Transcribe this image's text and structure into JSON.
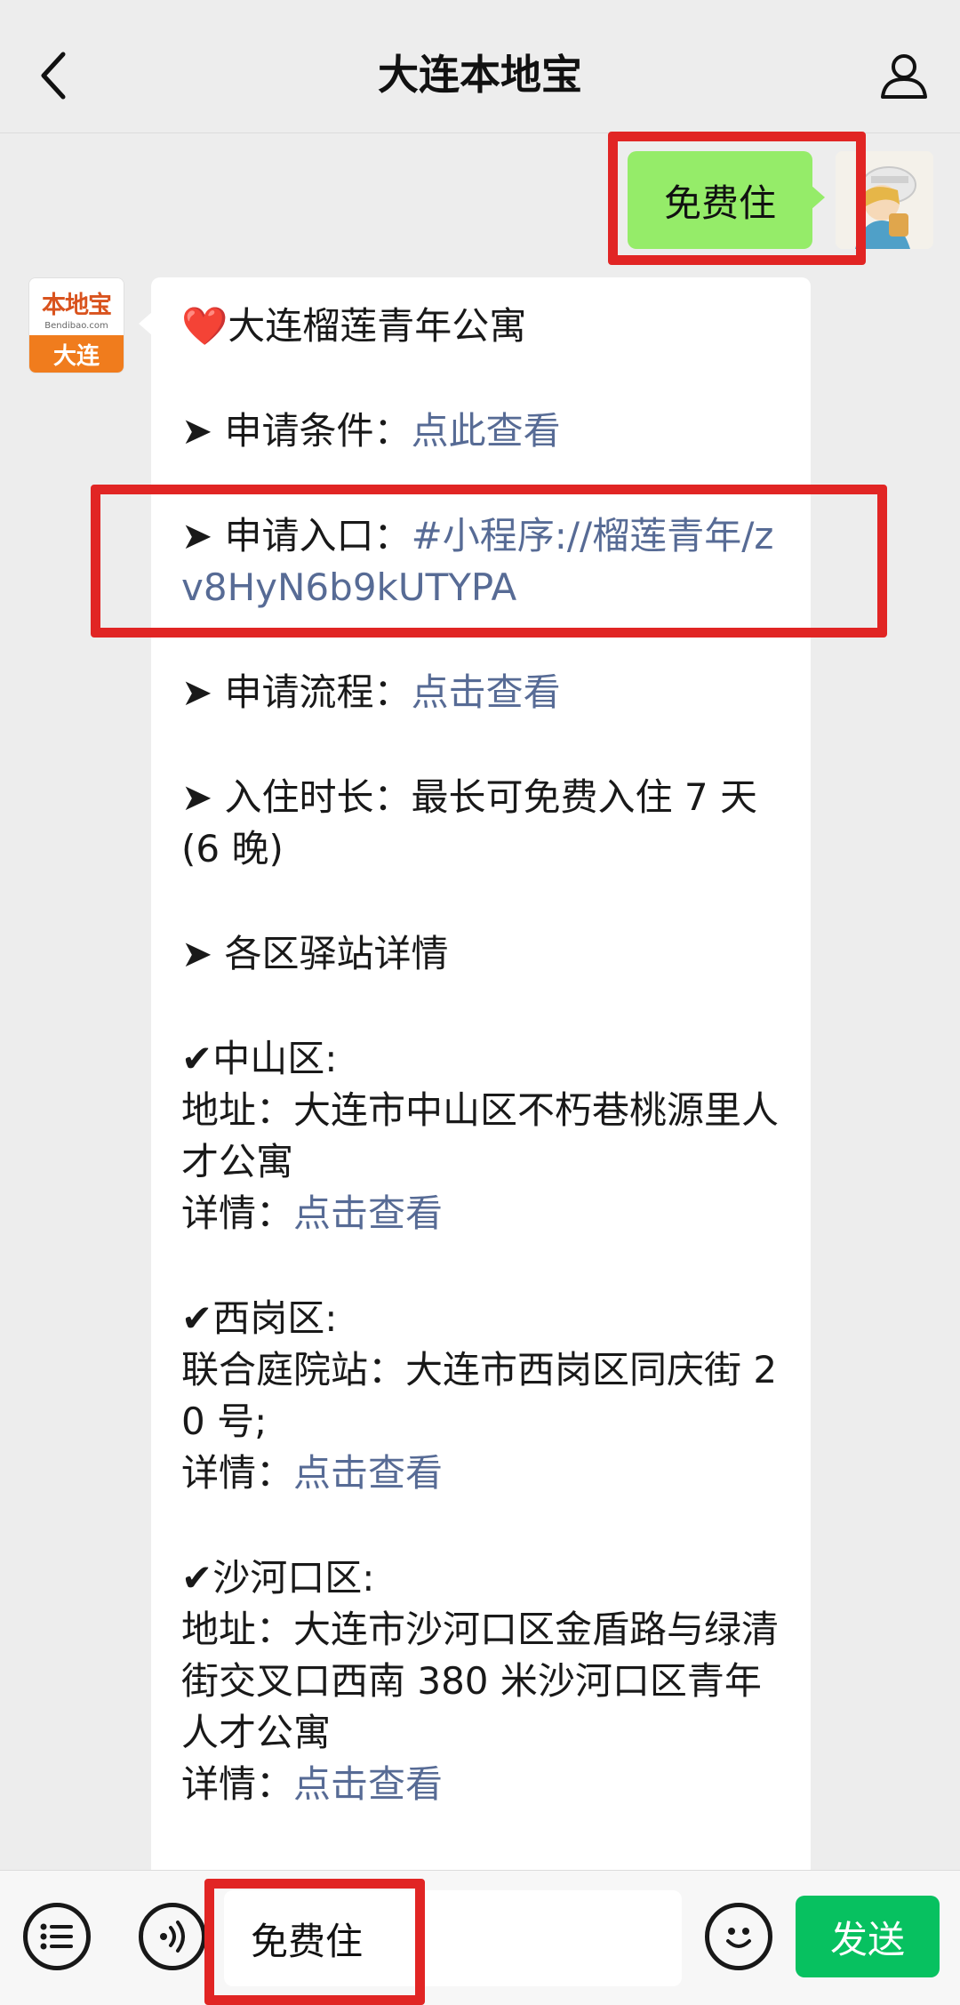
{
  "header": {
    "title": "大连本地宝",
    "back_icon": "chevron-left-icon",
    "profile_icon": "person-icon"
  },
  "outgoing": {
    "text": "免费住"
  },
  "bot_avatar": {
    "logo_text": "本地宝",
    "logo_sub": "Bendibao.com",
    "city": "大连"
  },
  "message": {
    "title": "❤️大连榴莲青年公寓",
    "items": [
      {
        "prefix": "➤ ",
        "label": "申请条件：",
        "link": "点此查看"
      },
      {
        "prefix": "➤ ",
        "label": "申请入口：",
        "link": "#小程序://榴莲青年/zv8HyN6b9kUTYPA"
      },
      {
        "prefix": "➤ ",
        "label": "申请流程：",
        "link": "点击查看"
      },
      {
        "prefix": "➤ ",
        "label": "入住时长：最长可免费入住 7 天(6 晚)"
      },
      {
        "prefix": "➤ ",
        "label": "各区驿站详情"
      }
    ],
    "districts": [
      {
        "name": "✔中山区:",
        "lines": [
          "地址：大连市中山区不朽巷桃源里人才公寓"
        ],
        "detail_label": "详情：",
        "detail_link": "点击查看"
      },
      {
        "name": "✔西岗区:",
        "lines": [
          "联合庭院站：大连市西岗区同庆街 20 号;"
        ],
        "detail_label": "详情：",
        "detail_link": "点击查看"
      },
      {
        "name": "✔沙河口区:",
        "lines": [
          "地址：大连市沙河口区金盾路与绿清街交叉口西南 380 米沙河口区青年人才公寓"
        ],
        "detail_label": "详情：",
        "detail_link": "点击查看"
      }
    ]
  },
  "input_bar": {
    "menu_icon": "list-menu-icon",
    "voice_icon": "voice-icon",
    "input_value": "免费住",
    "emoji_icon": "emoji-icon",
    "send_label": "发送"
  },
  "colors": {
    "link": "#576b95",
    "out_bubble": "#95ec69",
    "send": "#07c160",
    "highlight": "#e12524"
  }
}
